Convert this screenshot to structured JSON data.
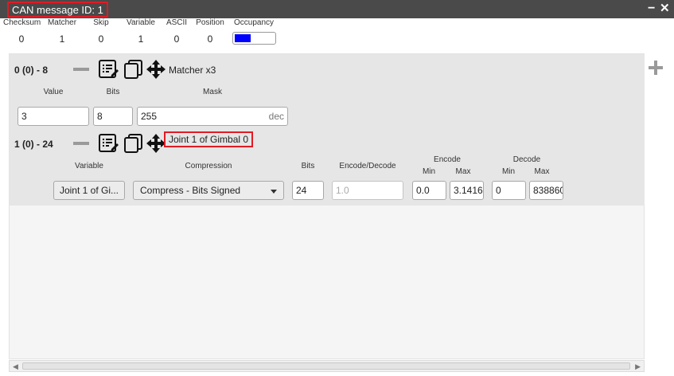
{
  "window": {
    "title": "CAN message ID: 1",
    "minimize_glyph": "−",
    "close_glyph": "✕"
  },
  "stats": [
    {
      "label": "Checksum",
      "value": "0"
    },
    {
      "label": "Matcher",
      "value": "1"
    },
    {
      "label": "Skip",
      "value": "0"
    },
    {
      "label": "Variable",
      "value": "1"
    },
    {
      "label": "ASCII",
      "value": "0"
    },
    {
      "label": "Position",
      "value": "0"
    },
    {
      "label": "Occupancy",
      "value": ""
    }
  ],
  "occupancy": {
    "fraction": 0.4,
    "color": "#0000ff"
  },
  "rows": [
    {
      "header": "0 (0) - 8",
      "label": "Matcher x3",
      "fields": {
        "value_label": "Value",
        "value": "3",
        "bits_label": "Bits",
        "bits": "8",
        "mask_label": "Mask",
        "mask": "255",
        "mask_suffix": "dec"
      }
    },
    {
      "header": "1 (0) - 24",
      "label": "Joint 1 of Gimbal 0",
      "fields": {
        "variable_label": "Variable",
        "variable": "Joint 1 of Gi...",
        "compression_label": "Compression",
        "compression": "Compress - Bits Signed",
        "bits_label": "Bits",
        "bits": "24",
        "encdec_label": "Encode/Decode",
        "encdec": "1.0",
        "encode_label": "Encode",
        "decode_label": "Decode",
        "min_label": "Min",
        "max_label": "Max",
        "encode_min": "0.0",
        "encode_max": "3.1416",
        "decode_min": "0",
        "decode_max": "838860"
      }
    }
  ],
  "icons": [
    "minus-icon",
    "edit-list-icon",
    "copy-icon",
    "move-icon",
    "add-icon"
  ],
  "colors": {
    "titlebar": "#4a4a4a",
    "highlight": "#e01b24",
    "group_bg": "#e6e6e6"
  }
}
